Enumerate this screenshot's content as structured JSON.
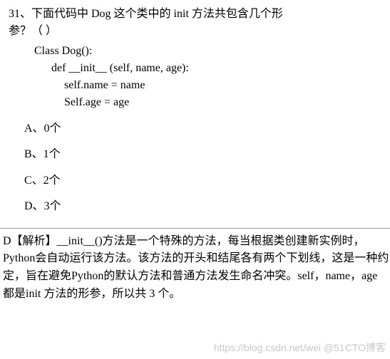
{
  "question": {
    "number_line1": "31、下面代码中 Dog 这个类中的 init 方法共包含几个形",
    "number_line2": "参？（ ）",
    "code": {
      "line1": "Class Dog():",
      "line2": "def __init__ (self, name, age):",
      "line3": "self.name = name",
      "line4": "Self.age = age"
    },
    "options": {
      "a": "A、0个",
      "b": "B、1个",
      "c": "C、2个",
      "d": "D、3个"
    }
  },
  "explanation": "D【解析】__init__()方法是一个特殊的方法，每当根据类创建新实例时，Python会自动运行该方法。该方法的开头和结尾各有两个下划线，这是一种约定，旨在避免Python的默认方法和普通方法发生命名冲突。self，name，age 都是init 方法的形参，所以共 3 个。",
  "watermark": "https://blog.csdn.net/wei @51CTO博客"
}
